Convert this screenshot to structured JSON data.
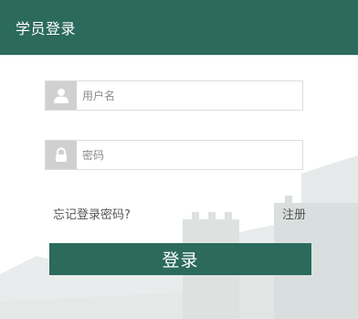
{
  "header": {
    "title": "学员登录"
  },
  "form": {
    "username_placeholder": "用户名",
    "username_value": "",
    "password_placeholder": "密码",
    "password_value": "",
    "forgot_label": "忘记登录密码?",
    "register_label": "注册",
    "login_label": "登录"
  },
  "icons": {
    "username": "user-icon",
    "password": "lock-icon"
  },
  "colors": {
    "brand": "#2b6a5c",
    "icon_box": "#d0d0d0",
    "icon": "#ffffff",
    "border": "#dcdcdc"
  }
}
